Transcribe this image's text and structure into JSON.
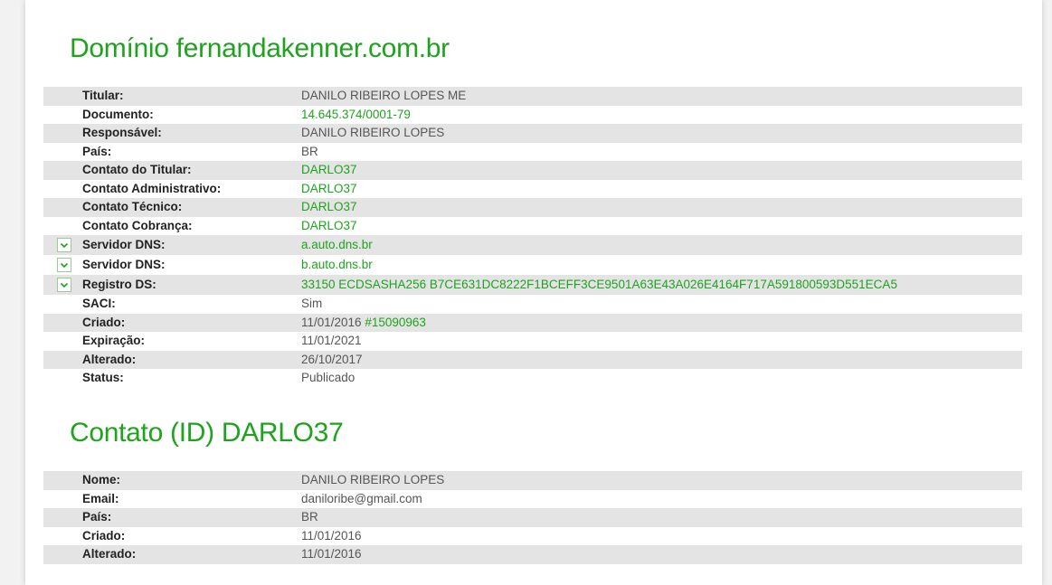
{
  "domain_section": {
    "title": "Domínio fernandakenner.com.br",
    "rows": [
      {
        "label": "Titular:",
        "value": "DANILO RIBEIRO LOPES ME"
      },
      {
        "label": "Documento:",
        "value": "14.645.374/0001-79"
      },
      {
        "label": "Responsável:",
        "value": "DANILO RIBEIRO LOPES"
      },
      {
        "label": "País:",
        "value": "BR"
      },
      {
        "label": "Contato do Titular:",
        "value": "DARLO37"
      },
      {
        "label": "Contato Administrativo:",
        "value": "DARLO37"
      },
      {
        "label": "Contato Técnico:",
        "value": "DARLO37"
      },
      {
        "label": "Contato Cobrança:",
        "value": "DARLO37"
      },
      {
        "label": "Servidor DNS:",
        "value": "a.auto.dns.br"
      },
      {
        "label": "Servidor DNS:",
        "value": "b.auto.dns.br"
      },
      {
        "label": "Registro DS:",
        "value": "33150 ECDSASHA256 B7CE631DC8222F1BCEFF3CE9501A63E43A026E4164F717A591800593D551ECA5"
      },
      {
        "label": "SACI:",
        "value": "Sim"
      },
      {
        "label": "Criado:",
        "value": "11/01/2016",
        "link": "#15090963"
      },
      {
        "label": "Expiração:",
        "value": "11/01/2021"
      },
      {
        "label": "Alterado:",
        "value": "26/10/2017"
      },
      {
        "label": "Status:",
        "value": "Publicado"
      }
    ]
  },
  "contact_section": {
    "title": "Contato (ID) DARLO37",
    "rows": [
      {
        "label": "Nome:",
        "value": "DANILO RIBEIRO LOPES"
      },
      {
        "label": "Email:",
        "value": "daniloribe@gmail.com"
      },
      {
        "label": "País:",
        "value": "BR"
      },
      {
        "label": "Criado:",
        "value": "11/01/2016"
      },
      {
        "label": "Alterado:",
        "value": "11/01/2016"
      }
    ]
  },
  "colors": {
    "accent": "#1ea31e",
    "row_stripe": "#e4e4e4"
  },
  "icons": {
    "expand": "chevron-down-icon"
  }
}
